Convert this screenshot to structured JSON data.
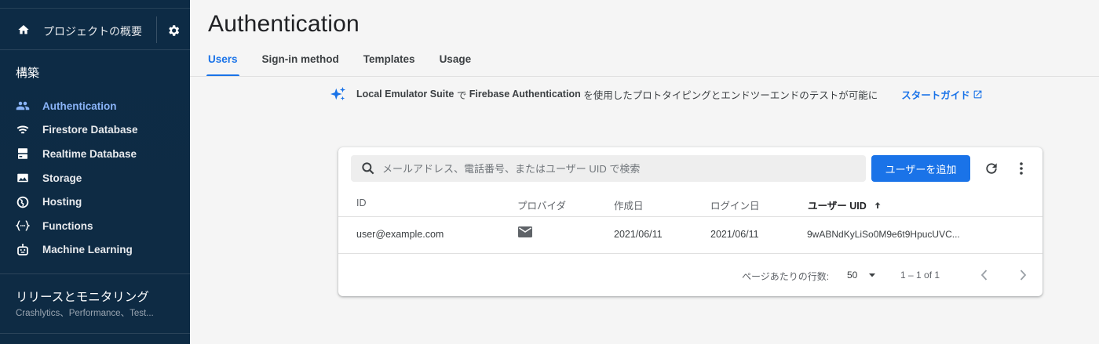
{
  "sidebar": {
    "project_label": "プロジェクトの概要",
    "section_build": "構築",
    "items": [
      {
        "label": "Authentication",
        "icon": "users-icon",
        "active": true
      },
      {
        "label": "Firestore Database",
        "icon": "wifi-icon",
        "active": false
      },
      {
        "label": "Realtime Database",
        "icon": "database-icon",
        "active": false
      },
      {
        "label": "Storage",
        "icon": "image-icon",
        "active": false
      },
      {
        "label": "Hosting",
        "icon": "globe-icon",
        "active": false
      },
      {
        "label": "Functions",
        "icon": "functions-icon",
        "active": false
      },
      {
        "label": "Machine Learning",
        "icon": "robot-icon",
        "active": false
      }
    ],
    "release_title": "リリースとモニタリング",
    "release_sub": "Crashlytics、Performance、Test..."
  },
  "header": {
    "title": "Authentication",
    "tabs": [
      {
        "label": "Users",
        "active": true
      },
      {
        "label": "Sign-in method",
        "active": false
      },
      {
        "label": "Templates",
        "active": false
      },
      {
        "label": "Usage",
        "active": false
      }
    ]
  },
  "banner": {
    "part1": "Local Emulator Suite",
    "part2": " で ",
    "part3": "Firebase Authentication",
    "part4": " を使用したプロトタイピングとエンドツーエンドのテストが可能に",
    "guide_label": "スタートガイド"
  },
  "users_table": {
    "search_placeholder": "メールアドレス、電話番号、またはユーザー UID で検索",
    "add_button": "ユーザーを追加",
    "columns": {
      "id": "ID",
      "provider": "プロバイダ",
      "created": "作成日",
      "signed_in": "ログイン日",
      "uid": "ユーザー UID"
    },
    "rows": [
      {
        "id": "user@example.com",
        "provider": "mail-icon",
        "created": "2021/06/11",
        "signed_in": "2021/06/11",
        "uid": "9wABNdKyLiSo0M9e6t9HpucUVC..."
      }
    ],
    "pager": {
      "rows_label": "ページあたりの行数:",
      "rows_value": "50",
      "range": "1 – 1 of 1"
    }
  },
  "colors": {
    "accent": "#1a73e8",
    "sidebar_bg": "#0e2b44",
    "sidebar_active": "#8ab4f8"
  }
}
